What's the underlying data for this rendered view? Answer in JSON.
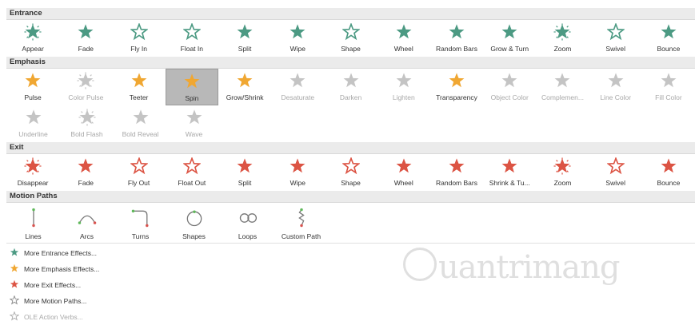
{
  "colors": {
    "entrance": "#4c9a83",
    "emphasis": "#f0a732",
    "exit": "#dc5444",
    "disabled": "#c4c4c4",
    "motion_line": "#777777",
    "motion_dot_start": "#5fb85a",
    "motion_dot_end": "#d9534f"
  },
  "sections": {
    "entrance": {
      "title": "Entrance",
      "items": [
        {
          "label": "Appear",
          "icon": "appear-star-icon"
        },
        {
          "label": "Fade",
          "icon": "fade-star-icon"
        },
        {
          "label": "Fly In",
          "icon": "fly-in-star-icon"
        },
        {
          "label": "Float In",
          "icon": "float-in-star-icon"
        },
        {
          "label": "Split",
          "icon": "split-star-icon"
        },
        {
          "label": "Wipe",
          "icon": "wipe-star-icon"
        },
        {
          "label": "Shape",
          "icon": "shape-star-icon"
        },
        {
          "label": "Wheel",
          "icon": "wheel-star-icon"
        },
        {
          "label": "Random Bars",
          "icon": "random-bars-star-icon"
        },
        {
          "label": "Grow & Turn",
          "icon": "grow-turn-star-icon"
        },
        {
          "label": "Zoom",
          "icon": "zoom-star-icon"
        },
        {
          "label": "Swivel",
          "icon": "swivel-star-icon"
        },
        {
          "label": "Bounce",
          "icon": "bounce-star-icon"
        }
      ]
    },
    "emphasis": {
      "title": "Emphasis",
      "items": [
        {
          "label": "Pulse",
          "icon": "pulse-star-icon",
          "disabled": false
        },
        {
          "label": "Color Pulse",
          "icon": "color-pulse-star-icon",
          "disabled": true
        },
        {
          "label": "Teeter",
          "icon": "teeter-star-icon",
          "disabled": false
        },
        {
          "label": "Spin",
          "icon": "spin-star-icon",
          "disabled": false,
          "selected": true
        },
        {
          "label": "Grow/Shrink",
          "icon": "grow-shrink-star-icon",
          "disabled": false
        },
        {
          "label": "Desaturate",
          "icon": "desaturate-star-icon",
          "disabled": true
        },
        {
          "label": "Darken",
          "icon": "darken-star-icon",
          "disabled": true
        },
        {
          "label": "Lighten",
          "icon": "lighten-star-icon",
          "disabled": true
        },
        {
          "label": "Transparency",
          "icon": "transparency-star-icon",
          "disabled": false
        },
        {
          "label": "Object Color",
          "icon": "object-color-star-icon",
          "disabled": true
        },
        {
          "label": "Complemen...",
          "icon": "complementary-star-icon",
          "disabled": true
        },
        {
          "label": "Line Color",
          "icon": "line-color-star-icon",
          "disabled": true
        },
        {
          "label": "Fill Color",
          "icon": "fill-color-star-icon",
          "disabled": true
        }
      ],
      "items_row2": [
        {
          "label": "Underline",
          "icon": "underline-star-icon",
          "disabled": true
        },
        {
          "label": "Bold Flash",
          "icon": "bold-flash-star-icon",
          "disabled": true
        },
        {
          "label": "Bold Reveal",
          "icon": "bold-reveal-star-icon",
          "disabled": true
        },
        {
          "label": "Wave",
          "icon": "wave-star-icon",
          "disabled": true
        }
      ]
    },
    "exit": {
      "title": "Exit",
      "items": [
        {
          "label": "Disappear",
          "icon": "disappear-star-icon"
        },
        {
          "label": "Fade",
          "icon": "fade-out-star-icon"
        },
        {
          "label": "Fly Out",
          "icon": "fly-out-star-icon"
        },
        {
          "label": "Float Out",
          "icon": "float-out-star-icon"
        },
        {
          "label": "Split",
          "icon": "split-out-star-icon"
        },
        {
          "label": "Wipe",
          "icon": "wipe-out-star-icon"
        },
        {
          "label": "Shape",
          "icon": "shape-out-star-icon"
        },
        {
          "label": "Wheel",
          "icon": "wheel-out-star-icon"
        },
        {
          "label": "Random Bars",
          "icon": "random-bars-out-star-icon"
        },
        {
          "label": "Shrink & Tu...",
          "icon": "shrink-turn-star-icon"
        },
        {
          "label": "Zoom",
          "icon": "zoom-out-star-icon"
        },
        {
          "label": "Swivel",
          "icon": "swivel-out-star-icon"
        },
        {
          "label": "Bounce",
          "icon": "bounce-out-star-icon"
        }
      ]
    },
    "motion": {
      "title": "Motion Paths",
      "items": [
        {
          "label": "Lines",
          "icon": "line-path-icon"
        },
        {
          "label": "Arcs",
          "icon": "arc-path-icon"
        },
        {
          "label": "Turns",
          "icon": "turn-path-icon"
        },
        {
          "label": "Shapes",
          "icon": "shape-path-icon"
        },
        {
          "label": "Loops",
          "icon": "loop-path-icon"
        },
        {
          "label": "Custom Path",
          "icon": "custom-path-icon"
        }
      ]
    }
  },
  "more": [
    {
      "label": "More Entrance Effects...",
      "icon": "entrance-star-icon",
      "disabled": false
    },
    {
      "label": "More Emphasis Effects...",
      "icon": "emphasis-star-icon",
      "disabled": false
    },
    {
      "label": "More Exit Effects...",
      "icon": "exit-star-icon",
      "disabled": false
    },
    {
      "label": "More Motion Paths...",
      "icon": "motion-path-star-icon",
      "disabled": false
    },
    {
      "label": "OLE Action Verbs...",
      "icon": "ole-verbs-icon",
      "disabled": true
    }
  ],
  "watermark": {
    "text": "uantrimang"
  }
}
